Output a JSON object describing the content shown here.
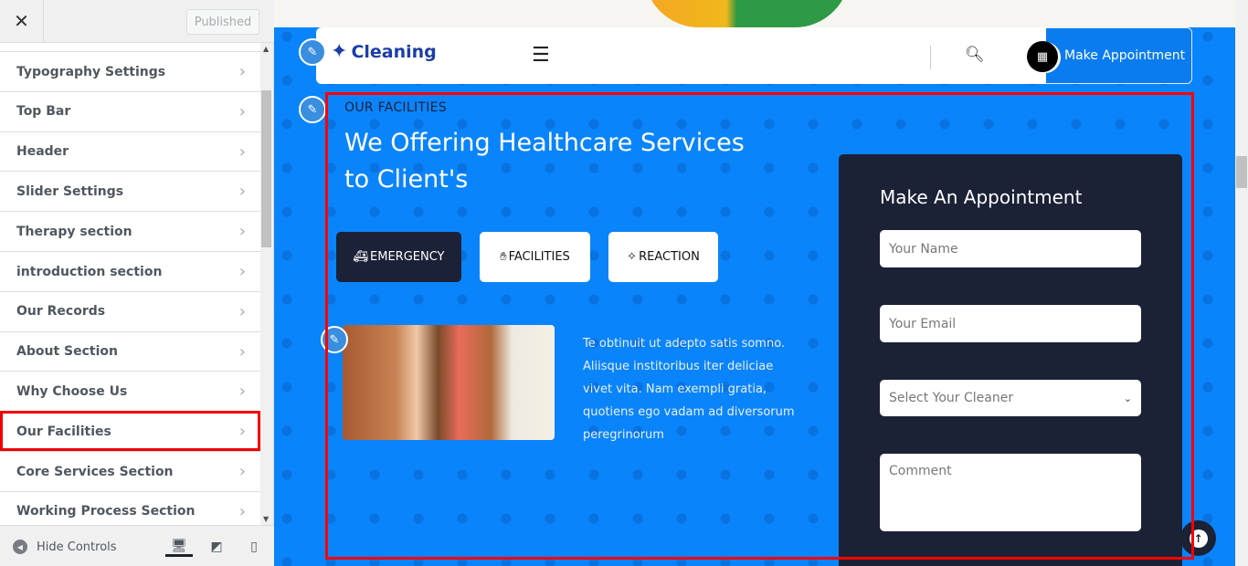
{
  "sidebar": {
    "close_icon": "close-icon",
    "published_label": "Published",
    "items": [
      {
        "label": "Typography Settings"
      },
      {
        "label": "Top Bar"
      },
      {
        "label": "Header"
      },
      {
        "label": "Slider Settings"
      },
      {
        "label": "Therapy section"
      },
      {
        "label": "introduction section"
      },
      {
        "label": "Our Records"
      },
      {
        "label": "About Section"
      },
      {
        "label": "Why Choose Us"
      },
      {
        "label": "Our Facilities",
        "highlighted": true
      },
      {
        "label": "Core Services Section"
      },
      {
        "label": "Working Process Section"
      }
    ],
    "hide_controls_label": "Hide Controls",
    "devices": [
      "desktop",
      "tablet",
      "mobile"
    ],
    "active_device": "desktop"
  },
  "preview": {
    "logo_text": "Cleaning",
    "appointment_button": "Make Appointment",
    "section": {
      "eyebrow": "OUR FACILITIES",
      "title": "We Offering Healthcare Services to Client's",
      "tabs": [
        {
          "label": "EMERGENCY",
          "icon": "ambulance-icon",
          "active": true
        },
        {
          "label": "FACILITIES",
          "icon": "hands-wash-icon",
          "active": false
        },
        {
          "label": "REACTION",
          "icon": "sparkle-icon",
          "active": false
        }
      ],
      "description": "Te obtinuit ut adepto satis somno. Aliisque institoribus iter deliciae vivet vita. Nam exempli gratia, quotiens ego vadam ad diversorum peregrinorum"
    },
    "form": {
      "title": "Make An Appointment",
      "name_placeholder": "Your Name",
      "email_placeholder": "Your Email",
      "cleaner_select": "Select Your Cleaner",
      "comment_placeholder": "Comment"
    }
  },
  "colors": {
    "brand_blue": "#0a84fa",
    "dark_navy": "#1b2236",
    "highlight_red": "#ff0000"
  }
}
